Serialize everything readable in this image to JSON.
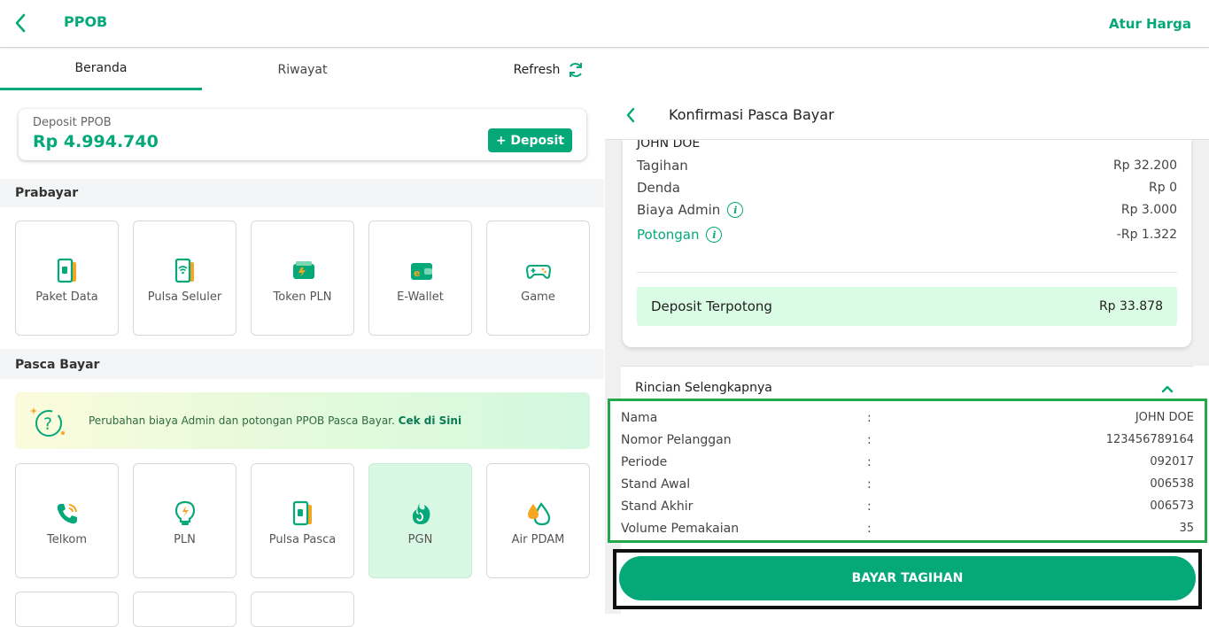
{
  "header": {
    "title": "PPOB",
    "action_label": "Atur Harga"
  },
  "tabs": {
    "beranda": "Beranda",
    "riwayat": "Riwayat",
    "refresh": "Refresh"
  },
  "deposit": {
    "label": "Deposit PPOB",
    "amount": "Rp 4.994.740",
    "button": "+ Deposit"
  },
  "prabayar": {
    "title": "Prabayar",
    "items": [
      {
        "label": "Paket Data",
        "icon": "phone-data-icon"
      },
      {
        "label": "Pulsa Seluler",
        "icon": "phone-signal-icon"
      },
      {
        "label": "Token PLN",
        "icon": "token-card-icon"
      },
      {
        "label": "E-Wallet",
        "icon": "wallet-icon"
      },
      {
        "label": "Game",
        "icon": "gamepad-icon"
      }
    ]
  },
  "pascabayar": {
    "title": "Pasca Bayar",
    "promo_text": "Perubahan biaya Admin dan potongan PPOB Pasca Bayar.",
    "promo_link": "Cek di Sini",
    "items": [
      {
        "label": "Telkom",
        "icon": "telephone-icon"
      },
      {
        "label": "PLN",
        "icon": "bulb-icon"
      },
      {
        "label": "Pulsa Pasca",
        "icon": "phone-card-icon"
      },
      {
        "label": "PGN",
        "icon": "flame-icon"
      },
      {
        "label": "Air PDAM",
        "icon": "water-drop-icon"
      }
    ]
  },
  "confirm": {
    "title": "Konfirmasi Pasca Bayar",
    "customer_name": "JOHN DOE",
    "rows": [
      {
        "label": "Tagihan",
        "value": "Rp 32.200"
      },
      {
        "label": "Denda",
        "value": "Rp 0"
      },
      {
        "label": "Biaya Admin",
        "value": "Rp 3.000"
      },
      {
        "label": "Potongan",
        "value": "-Rp 1.322"
      }
    ],
    "deposit_cut_label": "Deposit Terpotong",
    "deposit_cut_value": "Rp 33.878",
    "detail_title": "Rincian Selengkapnya",
    "details": [
      {
        "label": "Nama",
        "value": "JOHN DOE"
      },
      {
        "label": "Nomor Pelanggan",
        "value": "123456789164"
      },
      {
        "label": "Periode",
        "value": "092017"
      },
      {
        "label": "Stand Awal",
        "value": "006538"
      },
      {
        "label": "Stand Akhir",
        "value": "006573"
      },
      {
        "label": "Volume Pemakaian",
        "value": "35"
      }
    ],
    "colon": ":",
    "pay_button": "BAYAR TAGIHAN"
  },
  "colors": {
    "accent": "#05a878",
    "highlight": "#22a94b"
  }
}
